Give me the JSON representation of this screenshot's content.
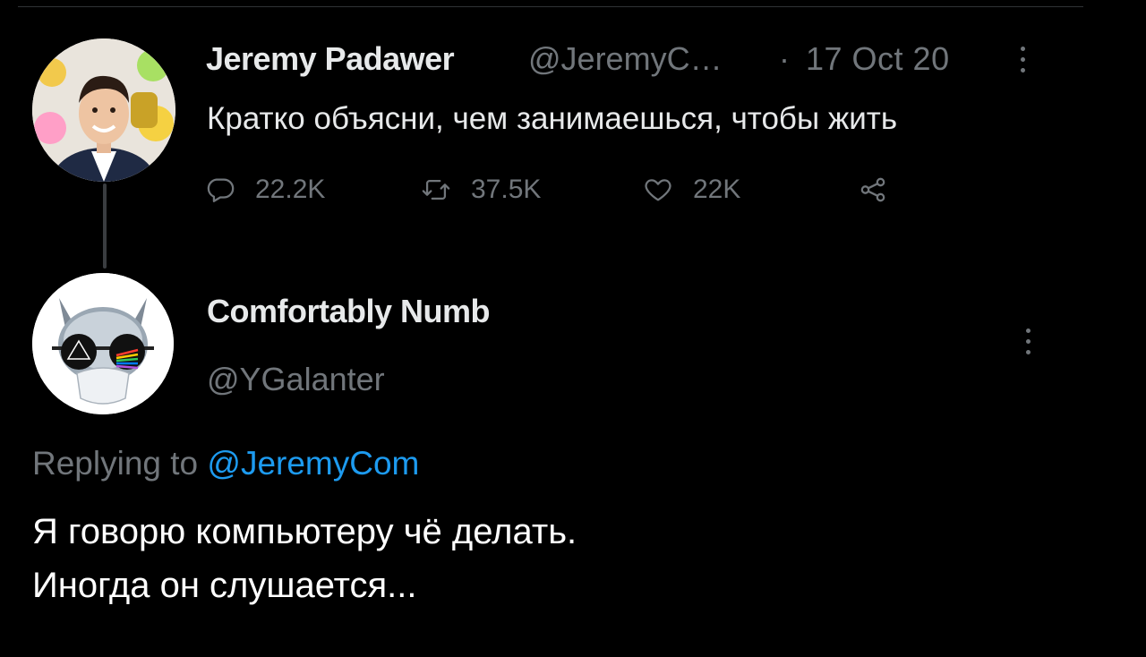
{
  "parent_tweet": {
    "author_name": "Jeremy Padawer",
    "handle": "@JeremyC…",
    "separator": "·",
    "date": "17 Oct 20",
    "text": "Кратко объясни, чем занимаешься, чтобы жить",
    "actions": {
      "replies": "22.2K",
      "retweets": "37.5K",
      "likes": "22K"
    },
    "avatar_icon": "profile-photo"
  },
  "reply_tweet": {
    "author_name": "Comfortably Numb",
    "handle": "@YGalanter",
    "replying_prefix": "Replying to",
    "replying_to": "@JeremyCom",
    "text_lines": [
      "Я говорю компьютеру чё делать.",
      "Иногда он слушается..."
    ],
    "avatar_icon": "cat-with-prism-glasses"
  },
  "colors": {
    "background": "#000000",
    "text": "#e7e9ea",
    "muted": "#71767b",
    "link": "#1d9bf0",
    "thread_line": "#3a3d40"
  }
}
